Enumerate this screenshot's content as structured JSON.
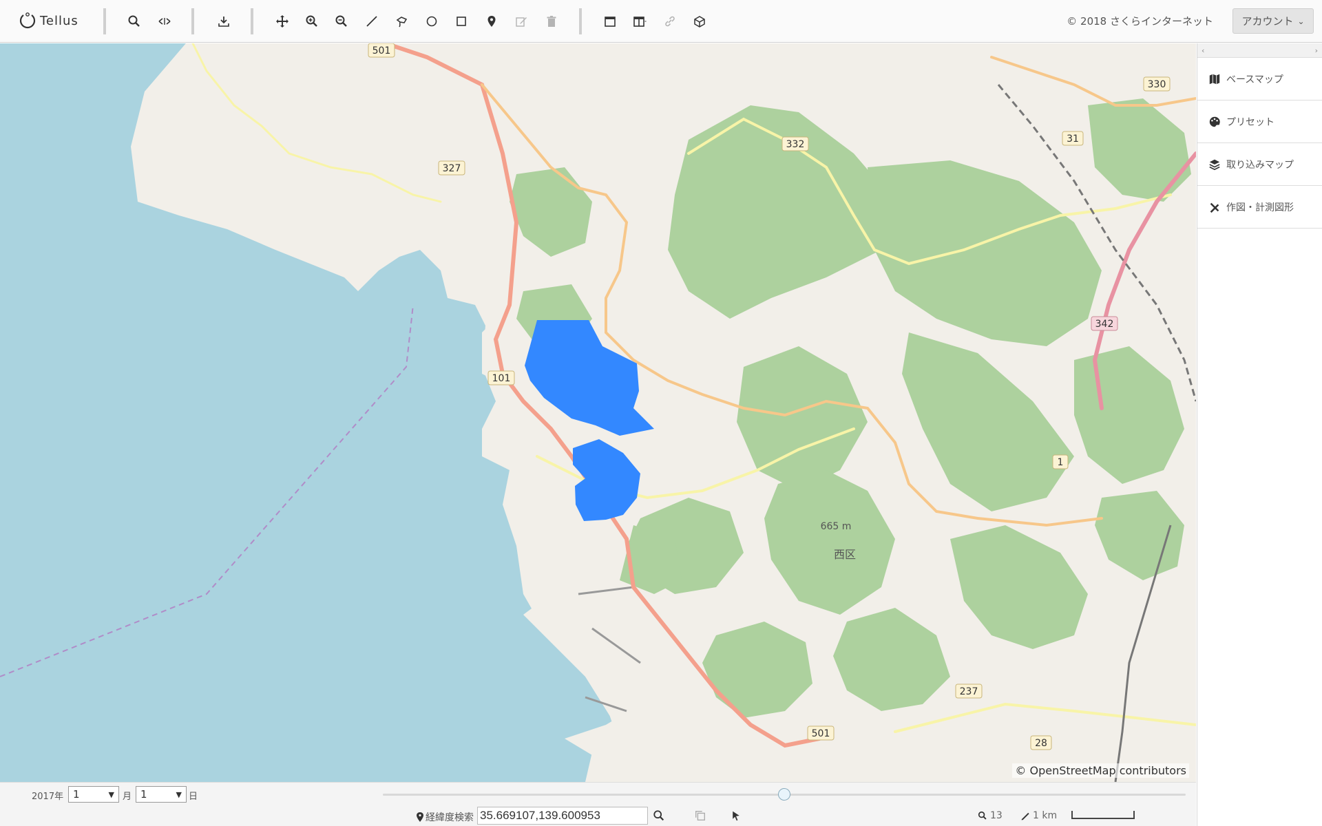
{
  "app": {
    "logo_text": "Tellus"
  },
  "toolbar": {
    "copyright": "© 2018 さくらインターネット",
    "account_label": "アカウント",
    "tools": [
      {
        "icon": "search-icon"
      },
      {
        "icon": "compare-icon"
      },
      {
        "icon": "download-icon"
      },
      {
        "icon": "pan-icon"
      },
      {
        "icon": "zoom-in-icon"
      },
      {
        "icon": "zoom-out-icon"
      },
      {
        "icon": "line-draw-icon"
      },
      {
        "icon": "lasso-icon"
      },
      {
        "icon": "circle-draw-icon"
      },
      {
        "icon": "rectangle-draw-icon"
      },
      {
        "icon": "pin-icon"
      },
      {
        "icon": "edit-icon"
      },
      {
        "icon": "trash-icon"
      },
      {
        "icon": "single-window-icon"
      },
      {
        "icon": "split-window-icon"
      },
      {
        "icon": "link-icon"
      },
      {
        "icon": "3d-box-icon"
      }
    ]
  },
  "map": {
    "attribution": "© OpenStreetMap contributors",
    "labels": [
      "501",
      "327",
      "332",
      "330",
      "31",
      "342",
      "101",
      "1",
      "237",
      "28",
      "665 m",
      "西区"
    ]
  },
  "sidepanel": {
    "items": [
      {
        "label": "ベースマップ",
        "icon": "map-icon"
      },
      {
        "label": "プリセット",
        "icon": "palette-icon"
      },
      {
        "label": "取り込みマップ",
        "icon": "layers-icon"
      },
      {
        "label": "作図・計測図形",
        "icon": "drawing-tools-icon"
      }
    ]
  },
  "datebar": {
    "year": "2017年",
    "month_value": "1",
    "month_unit": "月",
    "day_value": "1",
    "day_unit": "日"
  },
  "statusbar": {
    "coord_label": "経緯度検索",
    "coord_value": "35.669107,139.600953",
    "zoom_level": "13",
    "scale_label": "1 km"
  },
  "colors": {
    "water": "#aad3df",
    "land": "#f2efe9",
    "forest": "#add19e",
    "polygon": "#3388ff",
    "primary_road": "#f4a08c",
    "secondary_road": "#f7c78a",
    "tertiary_road": "#f8f4a8",
    "rail": "#888888"
  }
}
